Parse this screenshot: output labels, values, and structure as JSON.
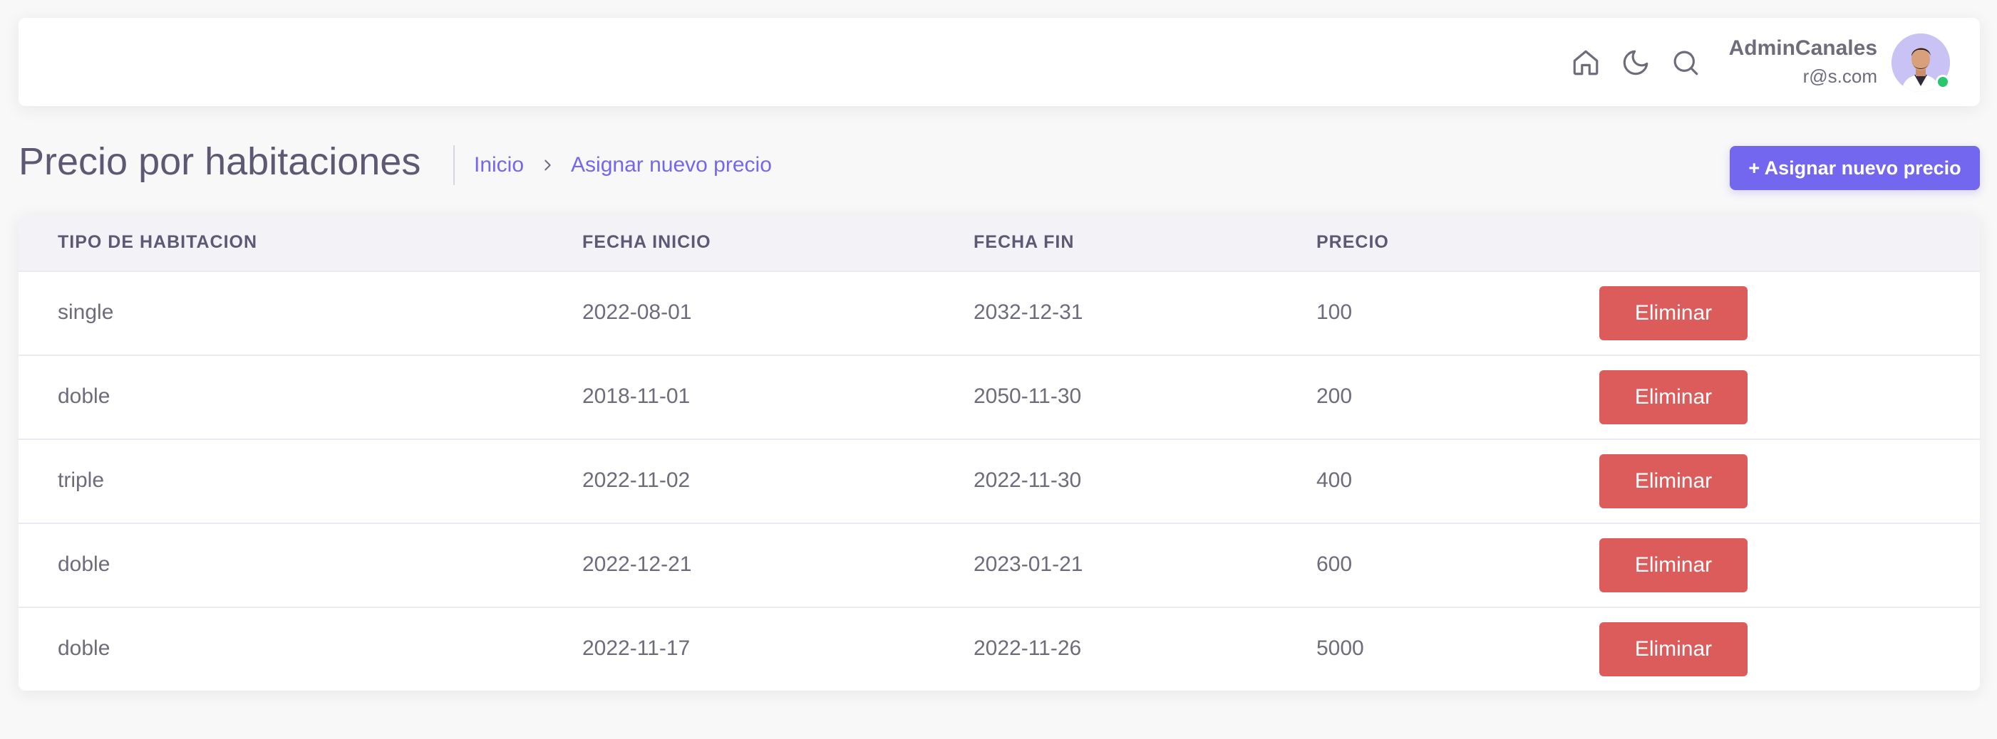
{
  "navbar": {
    "icons": [
      "home-icon",
      "moon-icon",
      "search-icon"
    ],
    "user": {
      "name": "AdminCanales",
      "email": "r@s.com",
      "status_color": "#28c76f"
    }
  },
  "page": {
    "title": "Precio por habitaciones",
    "breadcrumb": [
      "Inicio",
      "Asignar nuevo precio"
    ],
    "add_button_label": "+ Asignar nuevo precio"
  },
  "table": {
    "headers": [
      "TIPO DE HABITACION",
      "FECHA INICIO",
      "FECHA FIN",
      "PRECIO"
    ],
    "rows": [
      {
        "tipo": "single",
        "inicio": "2022-08-01",
        "fin": "2032-12-31",
        "precio": "100",
        "action": "Eliminar"
      },
      {
        "tipo": "doble",
        "inicio": "2018-11-01",
        "fin": "2050-11-30",
        "precio": "200",
        "action": "Eliminar"
      },
      {
        "tipo": "triple",
        "inicio": "2022-11-02",
        "fin": "2022-11-30",
        "precio": "400",
        "action": "Eliminar"
      },
      {
        "tipo": "doble",
        "inicio": "2022-12-21",
        "fin": "2023-01-21",
        "precio": "600",
        "action": "Eliminar"
      },
      {
        "tipo": "doble",
        "inicio": "2022-11-17",
        "fin": "2022-11-26",
        "precio": "5000",
        "action": "Eliminar"
      }
    ]
  },
  "colors": {
    "primary": "#7367f0",
    "danger": "#dc5c5c",
    "background": "#f8f8f8"
  }
}
